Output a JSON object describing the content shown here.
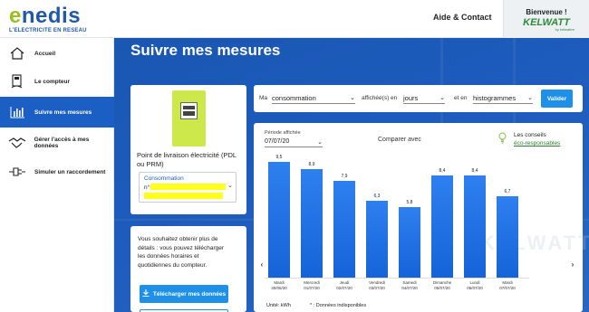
{
  "header": {
    "logo_text": "enedis",
    "logo_subtitle": "L'ELECTRICITE EN RESEAU",
    "help_link": "Aide & Contact",
    "welcome": "Bienvenue !",
    "brand": "KELWATT",
    "brand_sub": "by kelwattre"
  },
  "sidebar": {
    "items": [
      {
        "label": "Accueil",
        "icon": "house-icon"
      },
      {
        "label": "Le compteur",
        "icon": "meter-icon"
      },
      {
        "label": "Suivre mes mesures",
        "icon": "bar-chart-icon",
        "active": true
      },
      {
        "label": "Gérer l'accès à mes données",
        "icon": "handshake-icon"
      },
      {
        "label": "Simuler un raccordement",
        "icon": "plug-icon"
      }
    ]
  },
  "main": {
    "title": "Suivre mes mesures",
    "pdl_label": "Point de livraison électricité (PDL ou PRM)",
    "select_label": "Consommation",
    "select_value": "n°",
    "download_text": "Vous souhaitez obtenir plus de détails : vous pouvez télécharger les données horaires et quotidiennes du compteur.",
    "download_button": "Télécharger mes données"
  },
  "filters": {
    "ma": "Ma",
    "measure": "consommation",
    "displayed_in": "affichée(s) en",
    "unit": "jours",
    "and_in": "et en",
    "view": "histogrammes",
    "validate": "Valider"
  },
  "chart_panel": {
    "period_label": "Période affichée",
    "period_value": "07/07/20",
    "compare": "Comparer avec",
    "advice_line1": "Les conseils",
    "advice_line2": "éco-responsables",
    "unit_label": "Unité: kWh",
    "unavailable": "* : Données indisponibles",
    "watermark": "KELWATT"
  },
  "colors": {
    "brand_blue": "#1b5fc4",
    "accent_green": "#96c11f",
    "button_blue": "#1e90e8"
  },
  "chart_data": {
    "type": "bar",
    "categories": [
      "Mardi 30/06/20",
      "Mercredi 01/07/20",
      "Jeudi 02/07/20",
      "Vendredi 03/07/20",
      "Samedi 04/07/20",
      "Dimanche 05/07/20",
      "Lundi 06/07/20",
      "Mardi 07/07/20"
    ],
    "category_day": [
      "Mardi",
      "Mercredi",
      "Jeudi",
      "Vendredi",
      "Samedi",
      "Dimanche",
      "Lundi",
      "Mardi"
    ],
    "category_date": [
      "30/06/20",
      "01/07/20",
      "02/07/20",
      "03/07/20",
      "04/07/20",
      "05/07/20",
      "06/07/20",
      "07/07/20"
    ],
    "values": [
      9.5,
      8.9,
      7.9,
      6.3,
      5.8,
      8.4,
      8.4,
      6.7
    ],
    "value_labels": [
      "9,5",
      "8,9",
      "7,9",
      "6,3",
      "5,8",
      "8,4",
      "8,4",
      "6,7"
    ],
    "ylabel": "Unité: kWh",
    "ylim": [
      0,
      10.5
    ]
  }
}
